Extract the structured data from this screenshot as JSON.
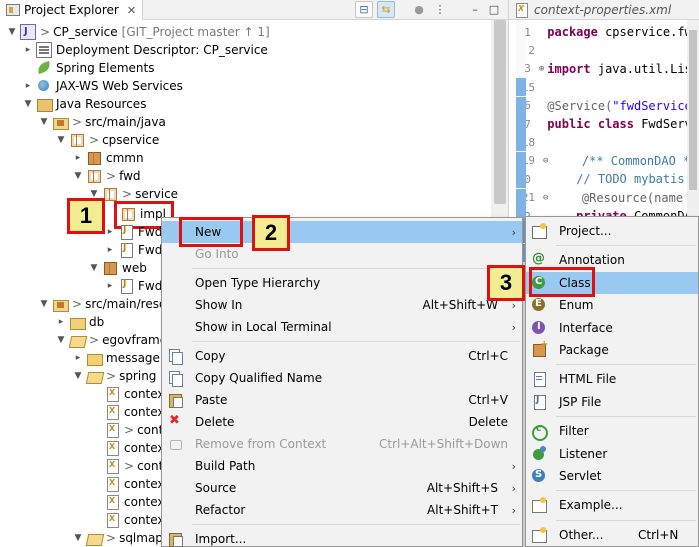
{
  "explorer": {
    "tab_title": "Project Explorer",
    "tab_close": "✕",
    "toolbar": {
      "collapse_icon": "⊟",
      "link_icon": "⇆",
      "focus_icon": "●",
      "view_menu_icon": "⋮",
      "minimize_icon": "–",
      "maximize_icon": "□"
    },
    "tree": {
      "project": {
        "prefix": ">",
        "name": "CP_service",
        "git": "[GIT_Project master ↑ 1]"
      },
      "deployment_descriptor": "Deployment Descriptor: CP_service",
      "spring_elements": "Spring Elements",
      "jaxws": "JAX-WS Web Services",
      "java_resources": "Java Resources",
      "src_main_java": {
        "prefix": ">",
        "name": "src/main/java"
      },
      "cpservice": {
        "prefix": ">",
        "name": "cpservice"
      },
      "cmmn": "cmmn",
      "fwd": {
        "prefix": ">",
        "name": "fwd"
      },
      "service": {
        "prefix": ">",
        "name": "service"
      },
      "impl": "impl",
      "fwd_file_1": "Fwd",
      "fwd_file_2": "Fwd",
      "web": "web",
      "fwd_file_3": "Fwd",
      "src_main_resources": {
        "prefix": ">",
        "name": "src/main/reso"
      },
      "db": "db",
      "egovframework": {
        "prefix": ">",
        "name": "egovframe"
      },
      "message": "message",
      "spring": {
        "prefix": ">",
        "name": "spring"
      },
      "context_files": [
        "contex",
        "contex",
        "cont",
        "contex",
        "cont",
        "contex",
        "contex",
        "contex"
      ],
      "context_prefixed": [
        false,
        false,
        true,
        false,
        true,
        false,
        false,
        false
      ],
      "sqlmap": {
        "prefix": ">",
        "name": "sqlmap"
      }
    }
  },
  "editor": {
    "tab_title": "context-properties.xml",
    "lines": [
      {
        "num": "1",
        "marker": "",
        "parts": [
          {
            "t": "package ",
            "c": "kw"
          },
          {
            "t": "cpservice.fwd",
            "c": ""
          }
        ]
      },
      {
        "num": "2",
        "marker": "",
        "parts": []
      },
      {
        "num": "3",
        "marker": "⊕",
        "parts": [
          {
            "t": "import ",
            "c": "kw"
          },
          {
            "t": "java.util.List",
            "c": ""
          }
        ]
      },
      {
        "num": "15",
        "marker": "",
        "parts": []
      },
      {
        "num": "16",
        "marker": "",
        "parts": [
          {
            "t": "@Service(",
            "c": "an"
          },
          {
            "t": "\"fwdService\"",
            "c": "st"
          }
        ]
      },
      {
        "num": "17",
        "marker": "",
        "parts": [
          {
            "t": "public class ",
            "c": "kw"
          },
          {
            "t": "FwdServi",
            "c": ""
          }
        ]
      },
      {
        "num": "18",
        "marker": "",
        "parts": []
      },
      {
        "num": "19",
        "marker": "⊖",
        "parts": [
          {
            "t": "    /** CommonDAO */",
            "c": "cm"
          }
        ]
      },
      {
        "num": "20",
        "marker": "",
        "parts": [
          {
            "t": "    // TODO mybatis ⁄",
            "c": "cm"
          }
        ]
      },
      {
        "num": "21",
        "marker": "⊖",
        "parts": [
          {
            "t": "    @Resource(name =",
            "c": "an"
          }
        ]
      },
      {
        "num": "22",
        "marker": "",
        "parts": [
          {
            "t": "    private ",
            "c": "kw"
          },
          {
            "t": "CommonDAO",
            "c": ""
          }
        ]
      },
      {
        "num": "23",
        "marker": "",
        "parts": []
      },
      {
        "num": "24",
        "marker": "⊖",
        "parts": [
          {
            "t": "    /**",
            "c": "cm"
          }
        ]
      }
    ]
  },
  "context_menu": {
    "items": [
      {
        "label": "New",
        "accel": "",
        "arrow": "›",
        "icon": "",
        "disabled": false,
        "highlight": true
      },
      {
        "label": "Go Into",
        "accel": "",
        "arrow": "",
        "icon": "",
        "disabled": true,
        "highlight": false
      },
      {
        "sep": true
      },
      {
        "label": "Open Type Hierarchy",
        "accel": "F4",
        "arrow": "",
        "icon": "",
        "disabled": false
      },
      {
        "label": "Show In",
        "accel": "Alt+Shift+W",
        "arrow": "›",
        "icon": "",
        "disabled": false
      },
      {
        "label": "Show in Local Terminal",
        "accel": "",
        "arrow": "›",
        "icon": "",
        "disabled": false
      },
      {
        "sep": true
      },
      {
        "label": "Copy",
        "accel": "Ctrl+C",
        "arrow": "",
        "icon": "copy-icon",
        "disabled": false
      },
      {
        "label": "Copy Qualified Name",
        "accel": "",
        "arrow": "",
        "icon": "copy-qualified-name-icon",
        "disabled": false
      },
      {
        "label": "Paste",
        "accel": "Ctrl+V",
        "arrow": "",
        "icon": "paste-icon",
        "disabled": false
      },
      {
        "label": "Delete",
        "accel": "Delete",
        "arrow": "",
        "icon": "delete-icon",
        "disabled": false
      },
      {
        "label": "Remove from Context",
        "accel": "Ctrl+Alt+Shift+Down",
        "arrow": "",
        "icon": "remove-from-context-icon",
        "disabled": true
      },
      {
        "label": "Build Path",
        "accel": "",
        "arrow": "›",
        "icon": "",
        "disabled": false
      },
      {
        "label": "Source",
        "accel": "Alt+Shift+S",
        "arrow": "›",
        "icon": "",
        "disabled": false
      },
      {
        "label": "Refactor",
        "accel": "Alt+Shift+T",
        "arrow": "›",
        "icon": "",
        "disabled": false
      },
      {
        "sep": true
      },
      {
        "label": "Import...",
        "accel": "",
        "arrow": "",
        "icon": "import-icon",
        "disabled": false
      }
    ]
  },
  "submenu": {
    "items": [
      {
        "label": "Project...",
        "icon": "project-icon",
        "accel": ""
      },
      {
        "sep": true
      },
      {
        "label": "Annotation",
        "icon": "annotation-icon",
        "accel": ""
      },
      {
        "label": "Class",
        "icon": "class-icon",
        "accel": "",
        "highlight": true
      },
      {
        "label": "Enum",
        "icon": "enum-icon",
        "accel": ""
      },
      {
        "label": "Interface",
        "icon": "interface-icon",
        "accel": ""
      },
      {
        "label": "Package",
        "icon": "package-icon",
        "accel": ""
      },
      {
        "sep": true
      },
      {
        "label": "HTML File",
        "icon": "html-file-icon",
        "accel": ""
      },
      {
        "label": "JSP File",
        "icon": "jsp-file-icon",
        "accel": ""
      },
      {
        "sep": true
      },
      {
        "label": "Filter",
        "icon": "filter-icon",
        "accel": ""
      },
      {
        "label": "Listener",
        "icon": "listener-icon",
        "accel": ""
      },
      {
        "label": "Servlet",
        "icon": "servlet-icon",
        "accel": ""
      },
      {
        "sep": true
      },
      {
        "label": "Example...",
        "icon": "example-icon",
        "accel": ""
      },
      {
        "sep": true
      },
      {
        "label": "Other...",
        "icon": "other-icon",
        "accel": "Ctrl+N"
      }
    ]
  },
  "steps": {
    "one": "1",
    "two": "2",
    "three": "3"
  },
  "colors": {
    "highlight": "#99c9f1",
    "callout_border": "#e01010",
    "callout_fill": "#f2ed93"
  }
}
